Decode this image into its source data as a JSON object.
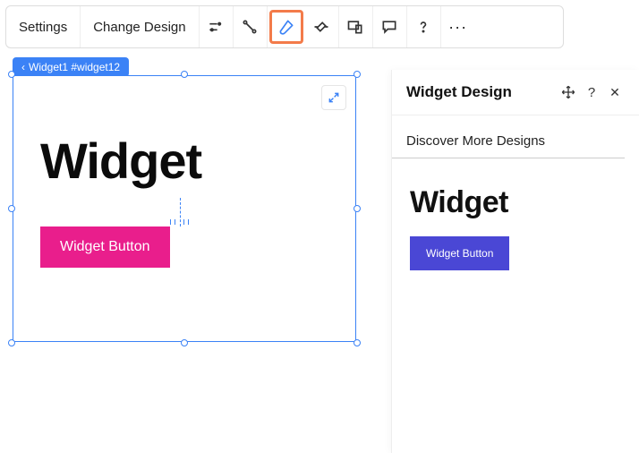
{
  "toolbar": {
    "settings_label": "Settings",
    "change_design_label": "Change Design",
    "icons": {
      "animations": "animations-icon",
      "connector": "connector-icon",
      "brush": "brush-icon",
      "stretch": "stretch-icon",
      "responsive": "responsive-icon",
      "comment": "comment-icon",
      "help": "help-icon",
      "more": "more-icon"
    },
    "more_label": "···"
  },
  "breadcrumb": {
    "label": "Widget1 #widget12",
    "chevron": "‹"
  },
  "canvas": {
    "title": "Widget",
    "button_label": "Widget Button"
  },
  "panel": {
    "title": "Widget Design",
    "subtitle": "Discover More Designs",
    "help_label": "?",
    "close_label": "✕",
    "preview": {
      "title": "Widget",
      "button_label": "Widget Button"
    }
  },
  "colors": {
    "accent_pink": "#e91e8c",
    "accent_blue": "#4a47d5",
    "select_blue": "#3b82f6",
    "active_orange": "#f37b4a"
  }
}
